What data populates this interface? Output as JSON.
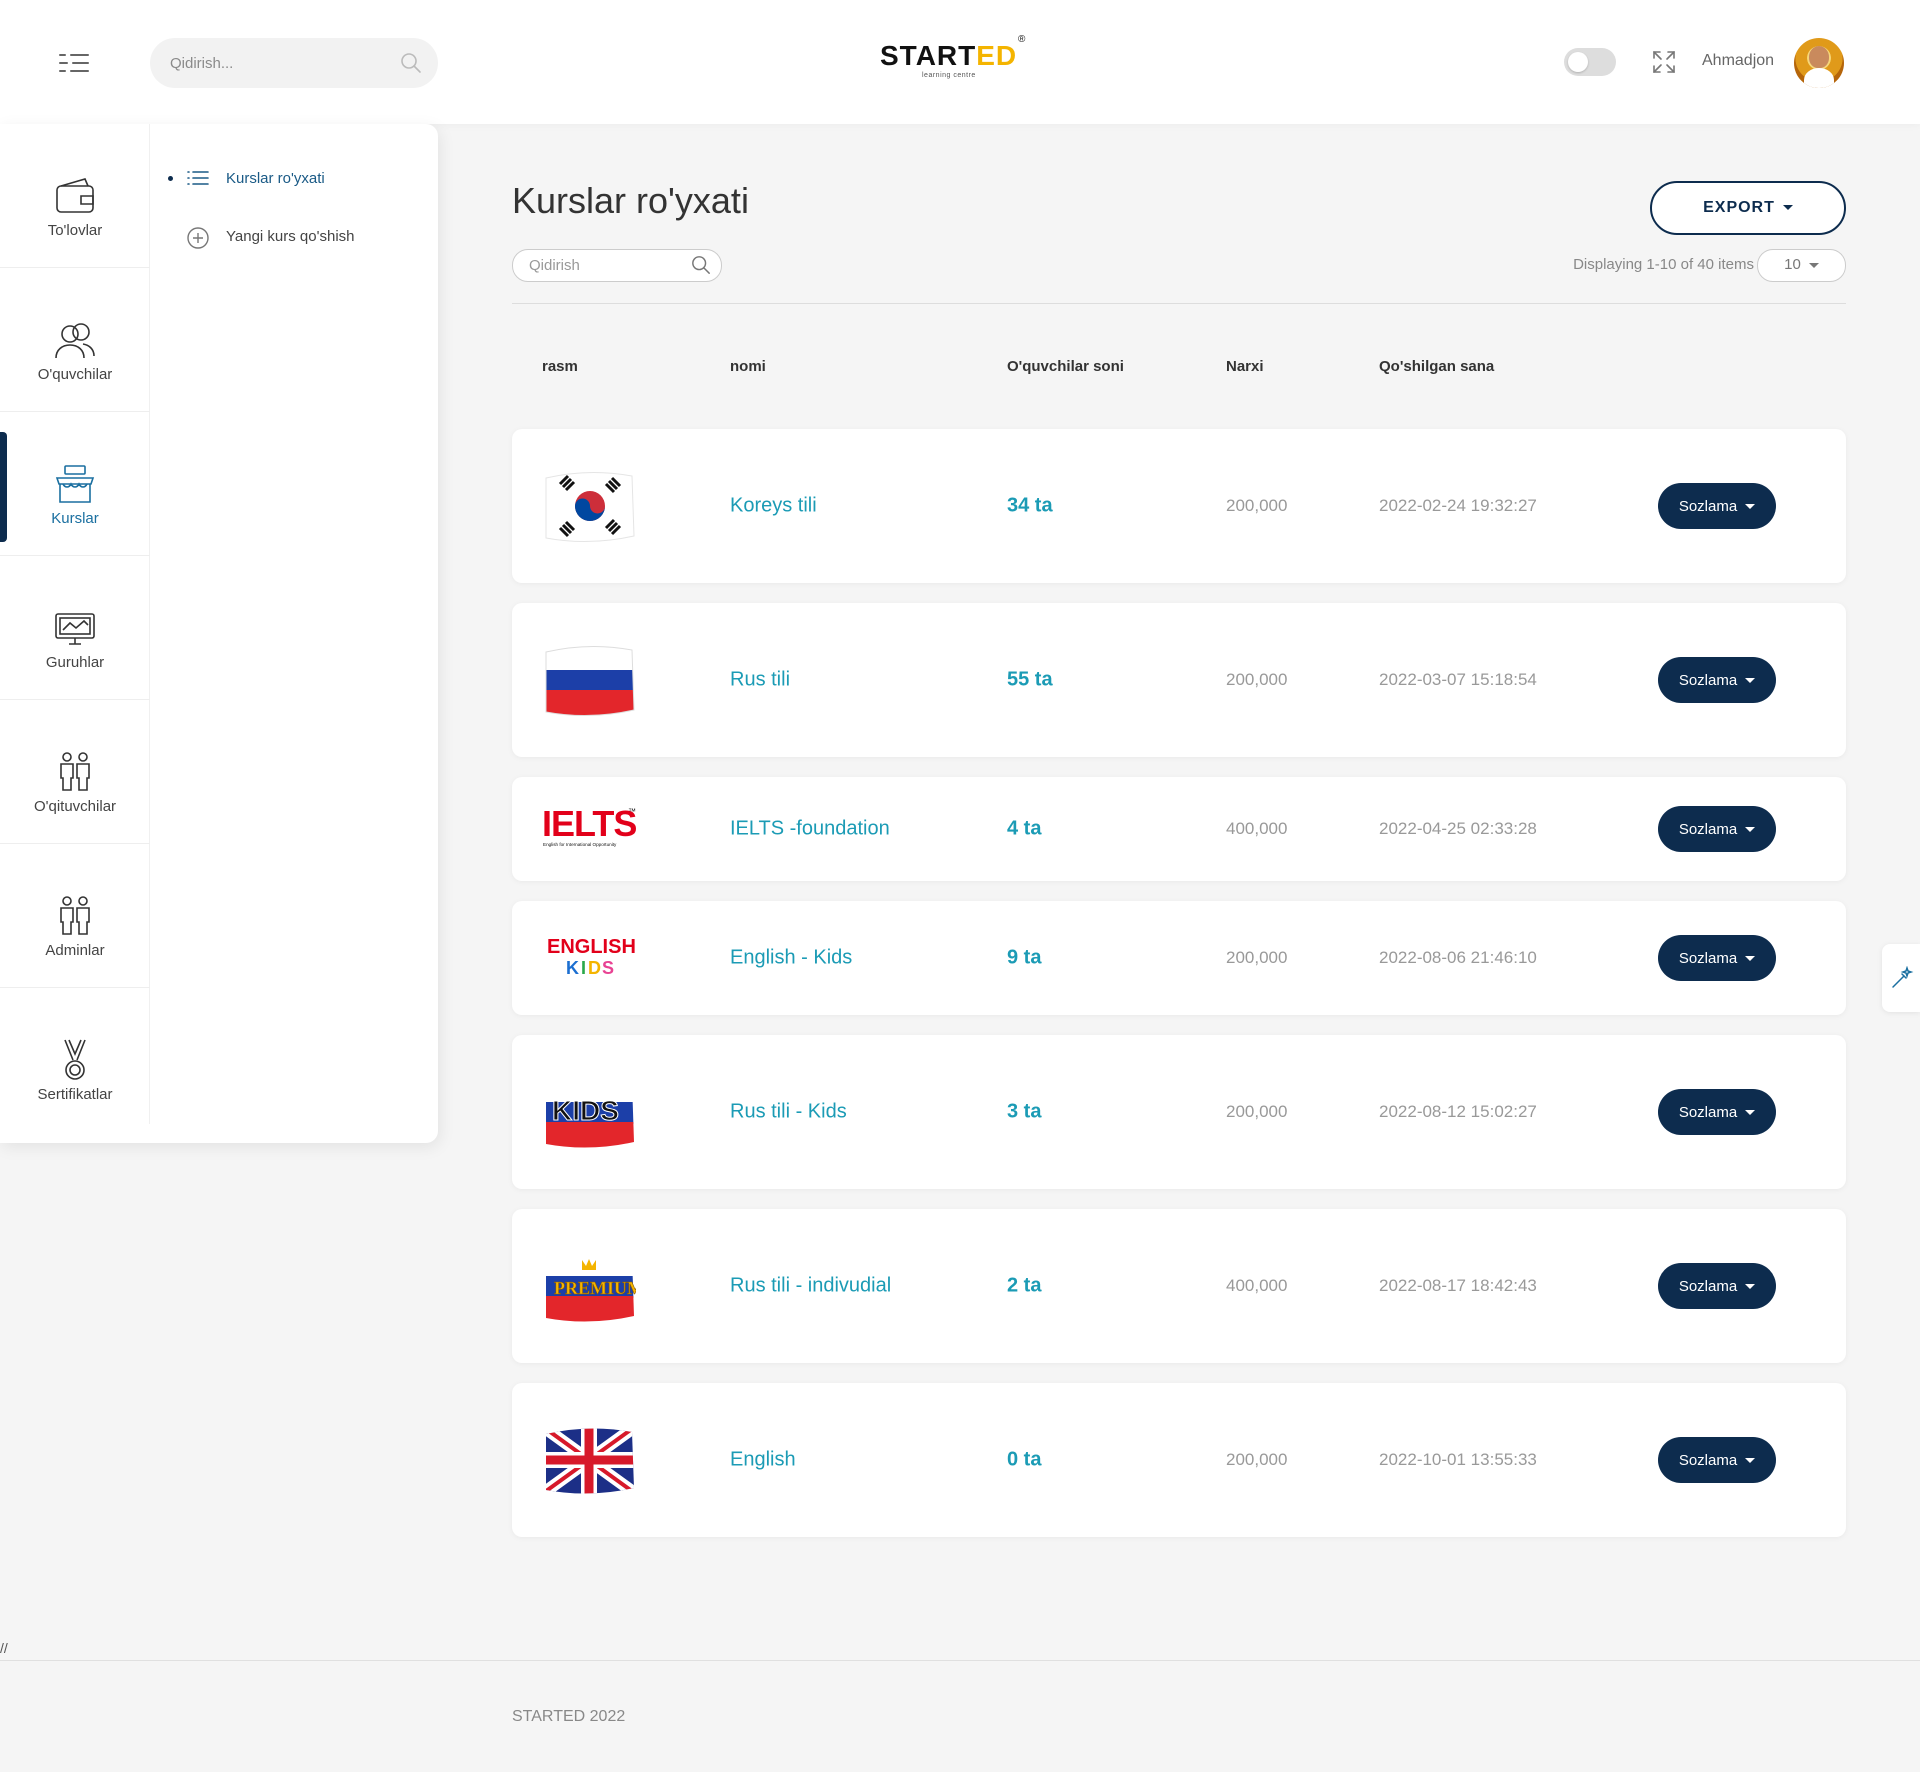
{
  "header": {
    "search_placeholder": "Qidirish...",
    "logo_text": "START",
    "logo_accent": "ED",
    "logo_reg": "®",
    "logo_sub": "learning centre",
    "username": "Ahmadjon"
  },
  "sidebar": {
    "items": [
      {
        "label": "To'lovlar",
        "icon": "wallet-icon"
      },
      {
        "label": "O'quvchilar",
        "icon": "users-icon"
      },
      {
        "label": "Kurslar",
        "icon": "shop-icon"
      },
      {
        "label": "Guruhlar",
        "icon": "monitor-icon"
      },
      {
        "label": "O'qituvchilar",
        "icon": "people-icon"
      },
      {
        "label": "Adminlar",
        "icon": "people-icon"
      },
      {
        "label": "Sertifikatlar",
        "icon": "medal-icon"
      }
    ],
    "active_index": 2,
    "sub_items": [
      {
        "label": "Kurslar ro'yxati",
        "icon": "list-icon"
      },
      {
        "label": "Yangi kurs qo'shish",
        "icon": "plus-circle-icon"
      }
    ]
  },
  "main": {
    "title": "Kurslar ro'yxati",
    "export_label": "EXPORT",
    "search_placeholder": "Qidirish",
    "displaying": "Displaying 1-10 of 40 items",
    "page_size": "10",
    "columns": [
      "rasm",
      "nomi",
      "O'quvchilar soni",
      "Narxi",
      "Qo'shilgan sana"
    ],
    "settings_label": "Sozlama",
    "rows": [
      {
        "image": "korea-flag",
        "name": "Koreys tili",
        "count": "34 ta",
        "price": "200,000",
        "date": "2022-02-24 19:32:27"
      },
      {
        "image": "russia-flag",
        "name": "Rus tili",
        "count": "55 ta",
        "price": "200,000",
        "date": "2022-03-07 15:18:54"
      },
      {
        "image": "ielts-logo",
        "name": "IELTS -foundation",
        "count": "4 ta",
        "price": "400,000",
        "date": "2022-04-25 02:33:28"
      },
      {
        "image": "english-kids-logo",
        "name": "English - Kids",
        "count": "9 ta",
        "price": "200,000",
        "date": "2022-08-06 21:46:10"
      },
      {
        "image": "russia-kids-flag",
        "name": "Rus tili - Kids",
        "count": "3 ta",
        "price": "200,000",
        "date": "2022-08-12 15:02:27"
      },
      {
        "image": "russia-premium-flag",
        "name": "Rus tili - indivudial",
        "count": "2 ta",
        "price": "400,000",
        "date": "2022-08-17 18:42:43"
      },
      {
        "image": "uk-flag",
        "name": "English",
        "count": "0 ta",
        "price": "200,000",
        "date": "2022-10-01 13:55:33"
      }
    ],
    "image_texts": {
      "ielts": "IELTS",
      "ielts_tm": "™",
      "ielts_sub": "English for International Opportunity",
      "english_kids_line1": "ENGLISH",
      "english_kids_line2": [
        "K",
        "I",
        "D",
        "S"
      ],
      "kids_on_flag": "KIDS",
      "premium_on_flag": "PREMIUM"
    }
  },
  "footer": {
    "slash": "//",
    "copyright": "STARTED 2022"
  },
  "colors": {
    "primary": "#0d2c4e",
    "accent": "#1b9bb5",
    "logo_accent": "#f4b400"
  }
}
